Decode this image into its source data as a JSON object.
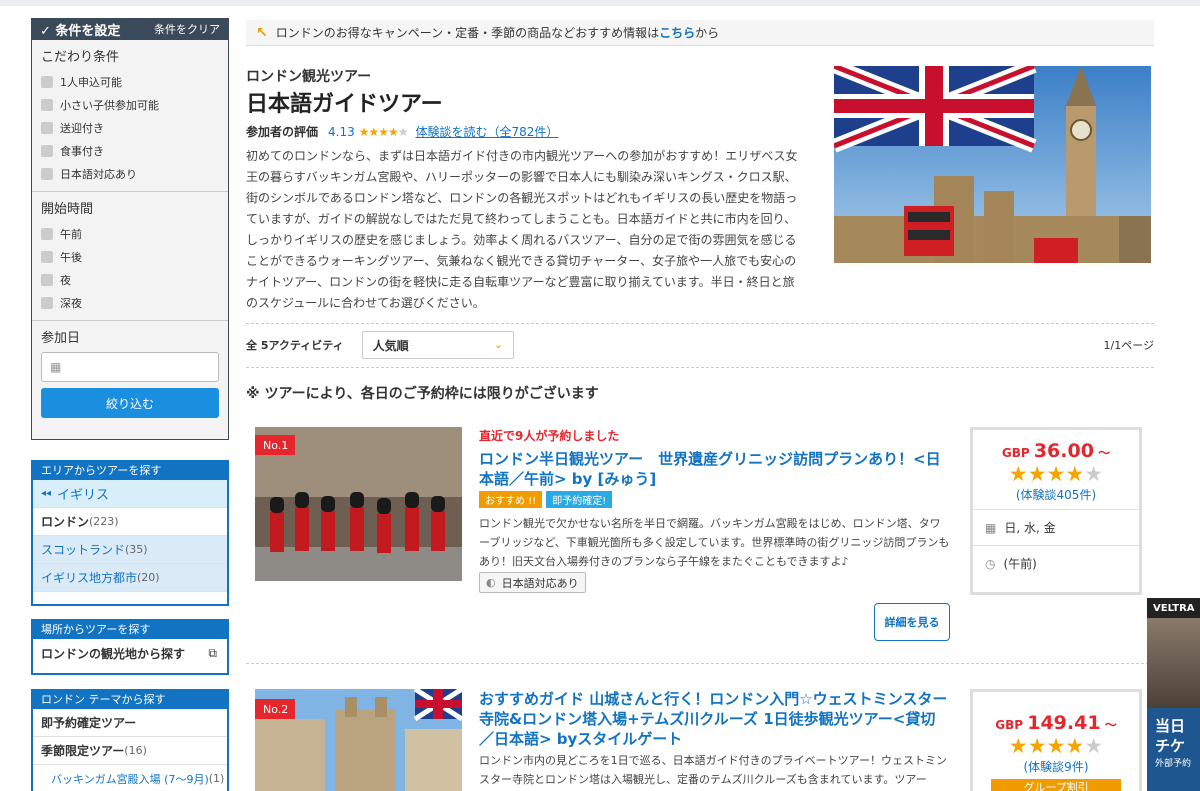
{
  "filter": {
    "title": "条件を設定",
    "clear": "条件をクリア",
    "sec1": {
      "title": "こだわり条件",
      "items": [
        "1人申込可能",
        "小さい子供参加可能",
        "送迎付き",
        "食事付き",
        "日本語対応あり"
      ]
    },
    "sec2": {
      "title": "開始時間",
      "items": [
        "午前",
        "午後",
        "夜",
        "深夜"
      ]
    },
    "sec3": {
      "title": "参加日",
      "submit": "絞り込む"
    }
  },
  "area": {
    "title": "エリアからツアーを探す",
    "current": "イギリス",
    "items": [
      {
        "name": "ロンドン",
        "count": "(223)"
      },
      {
        "name": "スコットランド",
        "count": "(35)"
      },
      {
        "name": "イギリス地方都市",
        "count": "(20)"
      }
    ]
  },
  "place": {
    "title": "場所からツアーを探す",
    "item": "ロンドンの観光地から探す"
  },
  "theme": {
    "title": "ロンドン テーマから探す",
    "items": [
      {
        "name": "即予約確定ツアー",
        "count": ""
      },
      {
        "name": "季節限定ツアー",
        "count": "(16)"
      },
      {
        "name": "バッキンガム宮殿入場 (7〜9月)",
        "count": "(1)"
      }
    ]
  },
  "banner": {
    "text": "ロンドンのお得なキャンペーン・定番・季節の商品などおすすめ情報は",
    "link": "こちら",
    "tail": "から"
  },
  "header": {
    "subtitle": "ロンドン観光ツアー",
    "title": "日本語ガイドツアー",
    "rating_label": "参加者の評価",
    "rating": "4.13",
    "stars": "★★★★",
    "star_off": "★",
    "reviews": "体験談を読む（全782件）",
    "desc": "初めてのロンドンなら、まずは日本語ガイド付きの市内観光ツアーへの参加がおすすめ！エリザベス女王の暮らすバッキンガム宮殿や、ハリーポッターの影響で日本人にも馴染み深いキングス・クロス駅、街のシンボルであるロンドン塔など、ロンドンの各観光スポットはどれもイギリスの長い歴史を物語っていますが、ガイドの解説なしではただ見て終わってしまうことも。日本語ガイドと共に市内を回り、しっかりイギリスの歴史を感じましょう。効率よく周れるバスツアー、自分の足で街の雰囲気を感じることができるウォーキングツアー、気兼ねなく観光できる貸切チャーター、女子旅や一人旅でも安心のナイトツアー、ロンドンの街を軽快に走る自転車ツアーなど豊富に取り揃えています。半日・終日と旅のスケジュールに合わせてお選びください。"
  },
  "sort": {
    "count": "全 5アクティビティ",
    "selected": "人気順",
    "page": "1/1ページ"
  },
  "notice": "※ ツアーにより、各日のご予約枠には限りがございます",
  "cards": [
    {
      "rank": "No.1",
      "alert": "直近で9人が予約しました",
      "title": "ロンドン半日観光ツアー　世界遺産グリニッジ訪問プランあり！<日本語／午前> by [みゅう]",
      "tag1": "おすすめ !!",
      "tag2": "即予約確定!",
      "desc": "ロンドン観光で欠かせない名所を半日で網羅。バッキンガム宮殿をはじめ、ロンドン塔、タワーブリッジなど、下車観光箇所も多く設定しています。世界標準時の街グリニッジ訪問プランもあり！旧天文台入場券付きのプランなら子午線をまたぐこともできますよ♪",
      "jp": "日本語対応あり",
      "detail": "詳細を見る",
      "cur": "GBP",
      "price": "36.00",
      "tilde": "〜",
      "stars": "★★★★",
      "star_off": "★",
      "reviews": "(体験談405件)",
      "days": "日, 水, 金",
      "time": "(午前)"
    },
    {
      "rank": "No.2",
      "title": "おすすめガイド 山城さんと行く！ロンドン入門☆ウェストミンスター寺院&ロンドン塔入場+テムズ川クルーズ 1日徒歩観光ツアー<貸切／日本語> byスタイルゲート",
      "desc": "ロンドン市内の見どころを1日で巡る、日本語ガイド付きのプライベートツアー！ウェストミンスター寺院とロンドン塔は入場観光し、定番のテムズ川クルーズも含まれています。ツアー",
      "cur": "GBP",
      "price": "149.41",
      "tilde": "〜",
      "stars": "★★★★",
      "star_off": "★",
      "reviews": "(体験談9件)",
      "group": "グループ割引"
    }
  ],
  "ad": {
    "brand": "VELTRA",
    "line1": "当日",
    "line2": "チケ",
    "small": "外部予約"
  }
}
